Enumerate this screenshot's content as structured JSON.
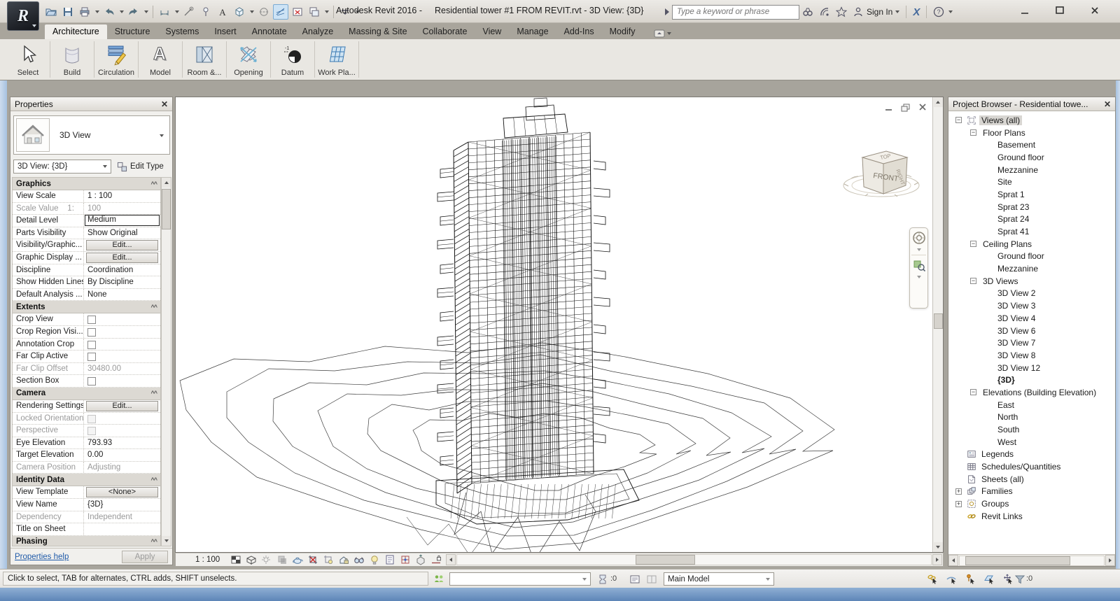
{
  "window": {
    "title_app": "Autodesk Revit 2016 -",
    "title_doc": "Residential tower #1 FROM REVIT.rvt - 3D View: {3D}",
    "search_placeholder": "Type a keyword or phrase",
    "sign_in": "Sign In",
    "exchange": "X",
    "help": "?"
  },
  "qat": {
    "icons": [
      {
        "icon": "open-icon"
      },
      {
        "icon": "save-icon"
      },
      {
        "icon": "print-icon",
        "caret": true
      },
      {
        "icon": "undo-icon",
        "caret": true
      },
      {
        "icon": "redo-icon",
        "caret": true
      },
      {
        "sep": true
      },
      {
        "icon": "aligned-dimension-icon",
        "caret": true
      },
      {
        "icon": "measure-icon"
      },
      {
        "icon": "tag-icon"
      },
      {
        "icon": "text-icon"
      },
      {
        "icon": "default-3d-view-icon",
        "caret": true
      },
      {
        "icon": "section-icon"
      },
      {
        "icon": "thin-lines-icon",
        "active": true
      },
      {
        "icon": "close-hidden-windows-icon"
      },
      {
        "icon": "switch-windows-icon",
        "caret": true
      },
      {
        "sep": true
      },
      {
        "icon": "customize-qat-icon",
        "caret": true
      }
    ]
  },
  "ribbon": {
    "active_tab": "Architecture",
    "tabs": [
      "Architecture",
      "Structure",
      "Systems",
      "Insert",
      "Annotate",
      "Analyze",
      "Massing & Site",
      "Collaborate",
      "View",
      "Manage",
      "Add-Ins",
      "Modify"
    ],
    "buttons": [
      {
        "label": "Select",
        "icon": "select-cursor-icon"
      },
      {
        "label": "Build",
        "icon": "build-wall-icon"
      },
      {
        "label": "Circulation",
        "icon": "circulation-stairs-icon"
      },
      {
        "label": "Model",
        "icon": "model-text-icon"
      },
      {
        "label": "Room &...",
        "icon": "room-area-icon"
      },
      {
        "label": "Opening",
        "icon": "opening-cross-icon"
      },
      {
        "label": "Datum",
        "icon": "datum-level-icon"
      },
      {
        "label": "Work Pla...",
        "icon": "work-plane-grid-icon"
      }
    ]
  },
  "properties_panel": {
    "title": "Properties",
    "type_name": "3D View",
    "type_icon": "house-3d-view-icon",
    "instance_selector": "3D View: {3D}",
    "edit_type_label": "Edit Type",
    "sections": [
      {
        "name": "Graphics",
        "rows": [
          {
            "label": "View Scale",
            "value": "1 : 100",
            "kind": "text"
          },
          {
            "label": "Scale Value    1:",
            "value": "100",
            "kind": "disabled"
          },
          {
            "label": "Detail Level",
            "value": "Medium",
            "kind": "editor"
          },
          {
            "label": "Parts Visibility",
            "value": "Show Original",
            "kind": "text"
          },
          {
            "label": "Visibility/Graphic...",
            "value": "Edit...",
            "kind": "button"
          },
          {
            "label": "Graphic Display ...",
            "value": "Edit...",
            "kind": "button"
          },
          {
            "label": "Discipline",
            "value": "Coordination",
            "kind": "text"
          },
          {
            "label": "Show Hidden Lines",
            "value": "By Discipline",
            "kind": "text"
          },
          {
            "label": "Default Analysis ...",
            "value": "None",
            "kind": "text"
          }
        ]
      },
      {
        "name": "Extents",
        "rows": [
          {
            "label": "Crop View",
            "value": "",
            "kind": "checkbox"
          },
          {
            "label": "Crop Region Visi...",
            "value": "",
            "kind": "checkbox"
          },
          {
            "label": "Annotation Crop",
            "value": "",
            "kind": "checkbox"
          },
          {
            "label": "Far Clip Active",
            "value": "",
            "kind": "checkbox"
          },
          {
            "label": "Far Clip Offset",
            "value": "30480.00",
            "kind": "disabled"
          },
          {
            "label": "Section Box",
            "value": "",
            "kind": "checkbox"
          }
        ]
      },
      {
        "name": "Camera",
        "rows": [
          {
            "label": "Rendering Settings",
            "value": "Edit...",
            "kind": "button"
          },
          {
            "label": "Locked Orientation",
            "value": "",
            "kind": "checkbox-disabled"
          },
          {
            "label": "Perspective",
            "value": "",
            "kind": "checkbox-disabled"
          },
          {
            "label": "Eye Elevation",
            "value": "793.93",
            "kind": "text"
          },
          {
            "label": "Target Elevation",
            "value": "0.00",
            "kind": "text"
          },
          {
            "label": "Camera Position",
            "value": "Adjusting",
            "kind": "disabled"
          }
        ]
      },
      {
        "name": "Identity Data",
        "rows": [
          {
            "label": "View Template",
            "value": "<None>",
            "kind": "button"
          },
          {
            "label": "View Name",
            "value": "{3D}",
            "kind": "text"
          },
          {
            "label": "Dependency",
            "value": "Independent",
            "kind": "disabled"
          },
          {
            "label": "Title on Sheet",
            "value": "",
            "kind": "text"
          }
        ]
      },
      {
        "name": "Phasing",
        "rows": []
      }
    ],
    "help_link": "Properties help",
    "apply_label": "Apply"
  },
  "viewport": {
    "scale_label": "1 : 100",
    "view_control_icons": [
      "detail-level-icon",
      "visual-style-icon",
      "sun-path-icon",
      "shadows-icon",
      "rendering-dialog-icon",
      "crop-view-icon",
      "crop-region-icon",
      "locked-3d-icon",
      "hide-isolate-icon",
      "reveal-hidden-icon",
      "temp-view-props-icon",
      "analytical-model-icon",
      "displacement-icon",
      "reveal-constraints-icon"
    ]
  },
  "viewcube": {
    "front": "FRONT",
    "top": "TOP",
    "right": "RIGHT"
  },
  "project_browser": {
    "title": "Project Browser - Residential towe...",
    "tree": [
      {
        "label": "Views (all)",
        "level": 0,
        "expander": "minus",
        "icon": "views-icon",
        "selected": true
      },
      {
        "label": "Floor Plans",
        "level": 1,
        "expander": "minus"
      },
      {
        "label": "Basement",
        "level": 2
      },
      {
        "label": "Ground floor",
        "level": 2
      },
      {
        "label": "Mezzanine",
        "level": 2
      },
      {
        "label": "Site",
        "level": 2
      },
      {
        "label": "Sprat 1",
        "level": 2
      },
      {
        "label": "Sprat 23",
        "level": 2
      },
      {
        "label": "Sprat 24",
        "level": 2
      },
      {
        "label": "Sprat 41",
        "level": 2
      },
      {
        "label": "Ceiling Plans",
        "level": 1,
        "expander": "minus"
      },
      {
        "label": "Ground floor",
        "level": 2
      },
      {
        "label": "Mezzanine",
        "level": 2
      },
      {
        "label": "3D Views",
        "level": 1,
        "expander": "minus"
      },
      {
        "label": "3D View 2",
        "level": 2
      },
      {
        "label": "3D View 3",
        "level": 2
      },
      {
        "label": "3D View 4",
        "level": 2
      },
      {
        "label": "3D View 6",
        "level": 2
      },
      {
        "label": "3D View 7",
        "level": 2
      },
      {
        "label": "3D View 8",
        "level": 2
      },
      {
        "label": "3D View 12",
        "level": 2
      },
      {
        "label": "{3D}",
        "level": 2,
        "bold": true
      },
      {
        "label": "Elevations (Building Elevation)",
        "level": 1,
        "expander": "minus"
      },
      {
        "label": "East",
        "level": 2
      },
      {
        "label": "North",
        "level": 2
      },
      {
        "label": "South",
        "level": 2
      },
      {
        "label": "West",
        "level": 2
      },
      {
        "label": "Legends",
        "level": 0,
        "icon": "legends-icon"
      },
      {
        "label": "Schedules/Quantities",
        "level": 0,
        "icon": "schedules-icon"
      },
      {
        "label": "Sheets (all)",
        "level": 0,
        "icon": "sheets-icon"
      },
      {
        "label": "Families",
        "level": 0,
        "expander": "plus",
        "icon": "families-icon"
      },
      {
        "label": "Groups",
        "level": 0,
        "expander": "plus",
        "icon": "groups-icon"
      },
      {
        "label": "Revit Links",
        "level": 0,
        "icon": "revit-links-icon"
      }
    ]
  },
  "status_bar": {
    "message": "Click to select, TAB for alternates, CTRL adds, SHIFT unselects.",
    "worksets_icon": "worksets-icon",
    "workset_value": "",
    "editing_requests_icon": "editing-requests-icon",
    "editing_requests": ":0",
    "design_option_icons": [
      "design-options-icon",
      "add-to-set-icon"
    ],
    "active_design_option": "Main Model",
    "selection_toggle_icons": [
      "select-links-icon",
      "select-underlay-icon",
      "select-pinned-icon",
      "select-by-face-icon",
      "drag-on-selection-icon"
    ],
    "filter_icon": "filter-icon",
    "filter_count": ":0"
  }
}
